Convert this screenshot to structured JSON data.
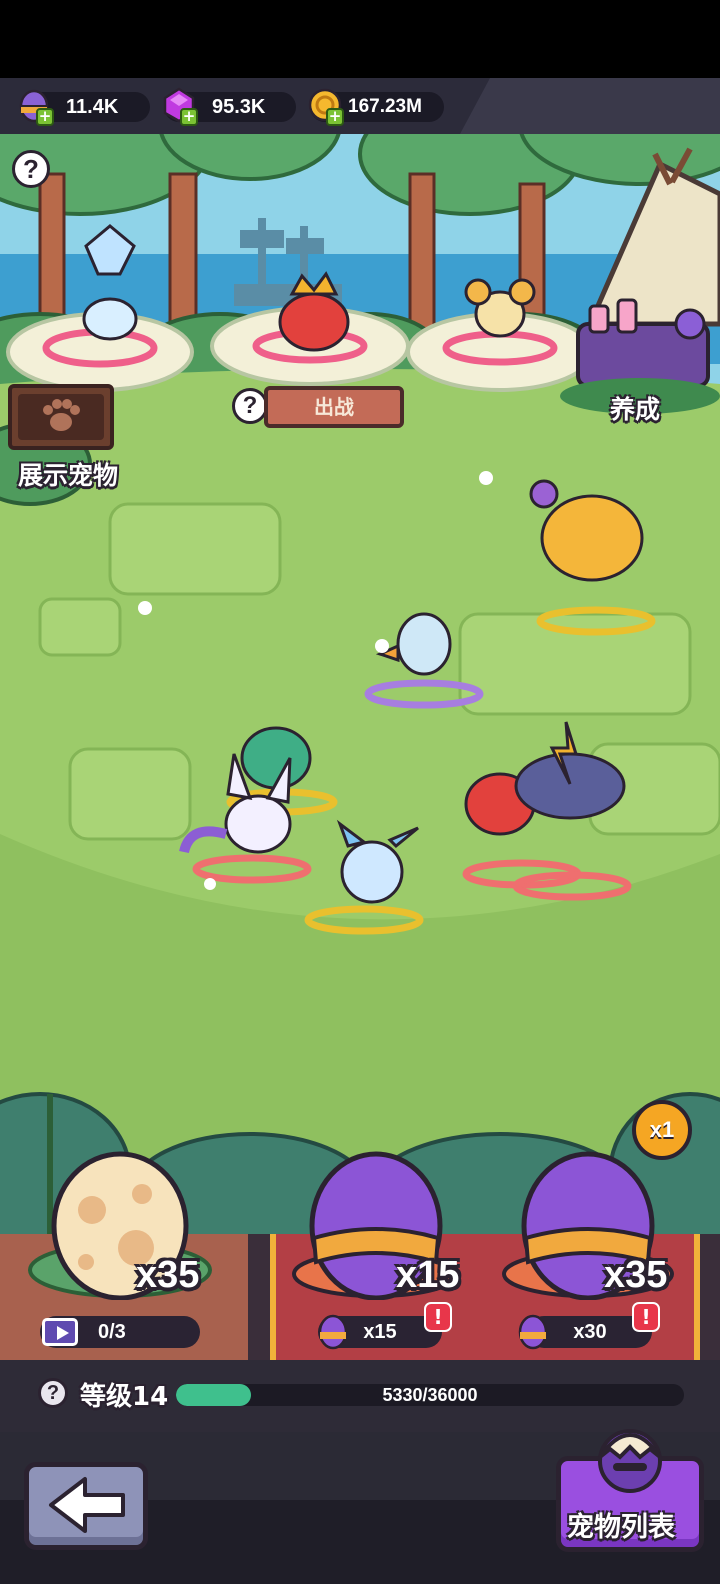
{
  "currencies": [
    {
      "icon": "egg-gem-icon",
      "value": "11.4K"
    },
    {
      "icon": "purple-gem-icon",
      "value": "95.3K"
    },
    {
      "icon": "gold-coin-icon",
      "value": "167.23M"
    }
  ],
  "scene": {
    "deploy_label": "出战",
    "showcase_label": "展示宠物",
    "nurture_label": "养成"
  },
  "eggs": [
    {
      "icon": "spotted-egg-icon",
      "count": "x35",
      "progress": "0/3"
    },
    {
      "icon": "purple-egg-icon",
      "count": "x15",
      "cost": "x15",
      "alert": "!"
    },
    {
      "icon": "purple-egg-icon",
      "count": "x35",
      "cost": "x30",
      "alert": "!"
    }
  ],
  "multiplier": "x1",
  "level": {
    "label": "等级14",
    "exp_text": "5330/36000",
    "current": 5330,
    "max": 36000
  },
  "nav": {
    "pet_list_label": "宠物列表"
  },
  "colors": {
    "grass": "#9ccb6a",
    "exp_fill": "#3fc08d",
    "alert": "#e8364a",
    "panel_red": "#b33f45"
  }
}
